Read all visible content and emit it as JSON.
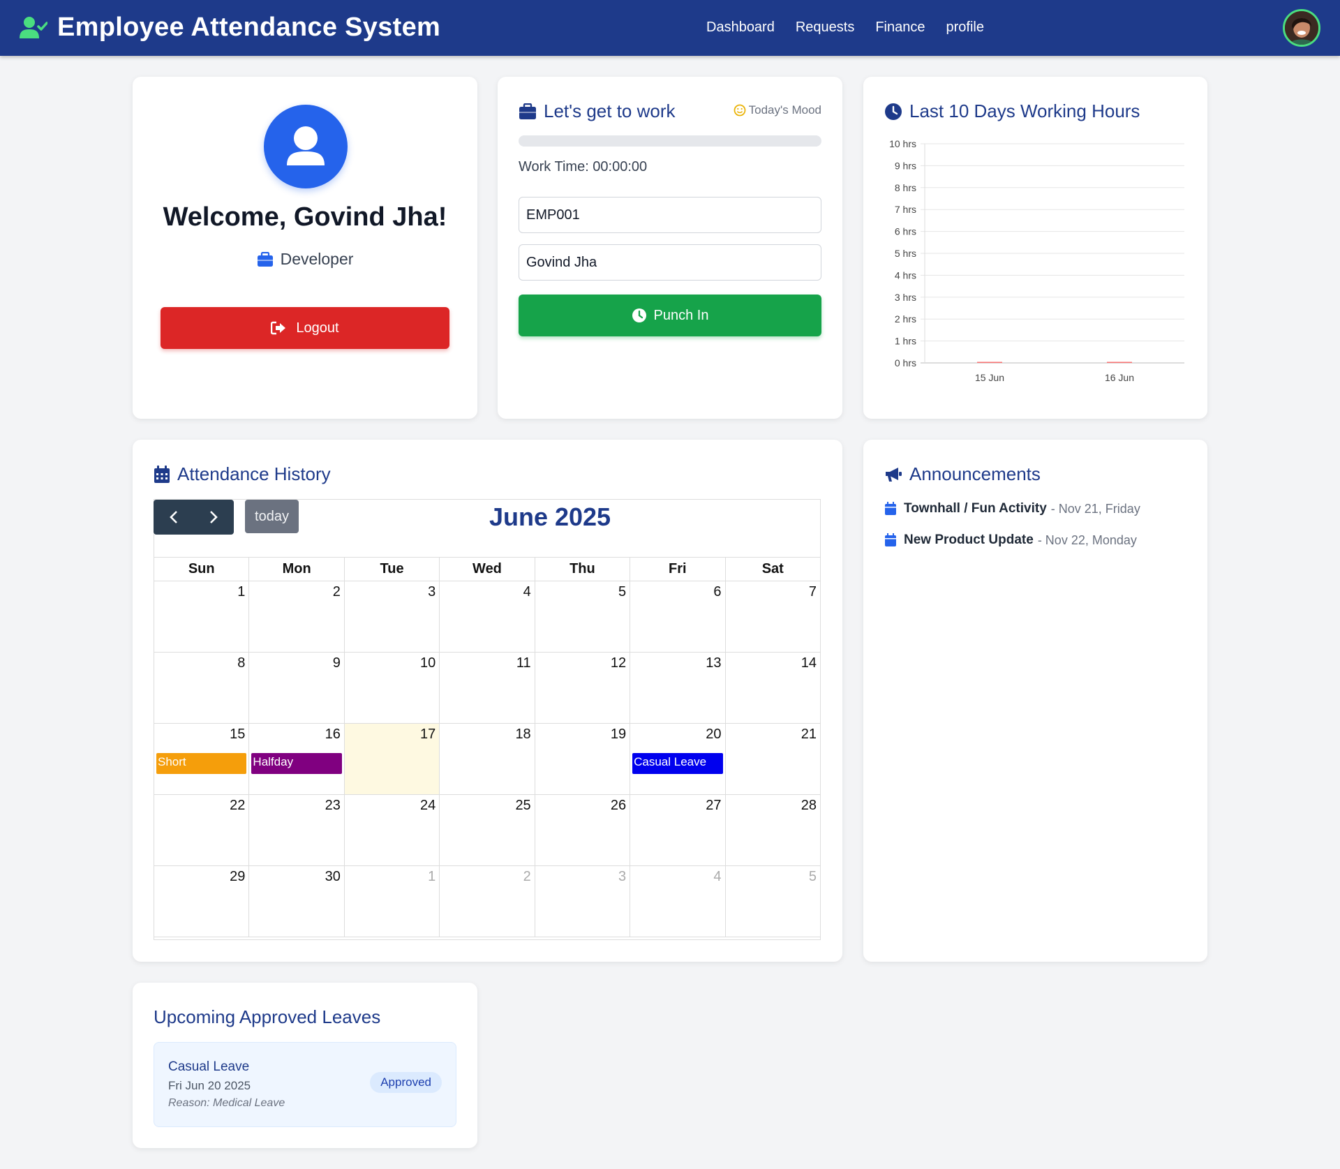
{
  "app": {
    "title": "Employee Attendance System",
    "nav": [
      "Dashboard",
      "Requests",
      "Finance",
      "profile"
    ]
  },
  "profile_card": {
    "welcome": "Welcome, Govind Jha!",
    "role": "Developer",
    "logout_label": "Logout"
  },
  "work_card": {
    "title": "Let's get to work",
    "mood_label": "Today's Mood",
    "progress": 0,
    "work_time": "Work Time: 00:00:00",
    "employee_id": "EMP001",
    "employee_name": "Govind Jha",
    "punch_label": "Punch In"
  },
  "hours_card": {
    "title": "Last 10 Days Working Hours",
    "chart_data": {
      "type": "bar",
      "categories": [
        "15 Jun",
        "16 Jun"
      ],
      "values": [
        0,
        0
      ],
      "ylim": [
        0,
        10
      ],
      "ytick_labels": [
        "0 hrs",
        "1 hrs",
        "2 hrs",
        "3 hrs",
        "4 hrs",
        "5 hrs",
        "6 hrs",
        "7 hrs",
        "8 hrs",
        "9 hrs",
        "10 hrs"
      ],
      "bar_color": "#f87171",
      "grid": true
    }
  },
  "attendance": {
    "title": "Attendance History",
    "today_label": "today",
    "month_title": "June 2025",
    "weekdays": [
      "Sun",
      "Mon",
      "Tue",
      "Wed",
      "Thu",
      "Fri",
      "Sat"
    ],
    "weeks": [
      [
        {
          "d": "1"
        },
        {
          "d": "2"
        },
        {
          "d": "3"
        },
        {
          "d": "4"
        },
        {
          "d": "5"
        },
        {
          "d": "6"
        },
        {
          "d": "7"
        }
      ],
      [
        {
          "d": "8"
        },
        {
          "d": "9"
        },
        {
          "d": "10"
        },
        {
          "d": "11"
        },
        {
          "d": "12"
        },
        {
          "d": "13"
        },
        {
          "d": "14"
        }
      ],
      [
        {
          "d": "15",
          "event": "Short",
          "color": "#f59e0b"
        },
        {
          "d": "16",
          "event": "Halfday",
          "color": "#800080"
        },
        {
          "d": "17",
          "today": true
        },
        {
          "d": "18"
        },
        {
          "d": "19"
        },
        {
          "d": "20",
          "event": "Casual Leave",
          "color": "#0000ee"
        },
        {
          "d": "21"
        }
      ],
      [
        {
          "d": "22"
        },
        {
          "d": "23"
        },
        {
          "d": "24"
        },
        {
          "d": "25"
        },
        {
          "d": "26"
        },
        {
          "d": "27"
        },
        {
          "d": "28"
        }
      ],
      [
        {
          "d": "29"
        },
        {
          "d": "30"
        },
        {
          "d": "1",
          "other": true
        },
        {
          "d": "2",
          "other": true
        },
        {
          "d": "3",
          "other": true
        },
        {
          "d": "4",
          "other": true
        },
        {
          "d": "5",
          "other": true
        }
      ]
    ]
  },
  "announcements": {
    "title": "Announcements",
    "items": [
      {
        "title": "Townhall / Fun Activity",
        "date": "- Nov 21, Friday"
      },
      {
        "title": "New Product Update",
        "date": "- Nov 22, Monday"
      }
    ]
  },
  "leaves": {
    "title": "Upcoming Approved Leaves",
    "items": [
      {
        "type": "Casual Leave",
        "date": "Fri Jun 20 2025",
        "reason": "Reason: Medical Leave",
        "status": "Approved"
      }
    ]
  },
  "colors": {
    "navbar": "#1e3a8a",
    "accent": "#2563eb",
    "logout": "#dc2626",
    "punch": "#16a34a"
  }
}
